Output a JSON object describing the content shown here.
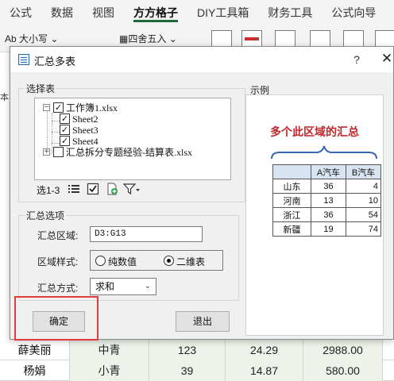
{
  "ribbon": {
    "tabs": [
      "公式",
      "数据",
      "视图",
      "方方格子",
      "DIY工具箱",
      "财务工具",
      "公式向导"
    ],
    "active_tab": "方方格子",
    "tools": {
      "font_case": "Ab 大小写",
      "round": "四舍五入"
    }
  },
  "sheet": {
    "left_partial_text": "本",
    "rows": [
      [
        "薛美丽",
        "中青",
        "123",
        "24.29",
        "2988.00"
      ],
      [
        "杨娟",
        "小青",
        "39",
        "14.87",
        "580.00"
      ]
    ]
  },
  "dialog": {
    "title": "汇总多表",
    "help": "?",
    "close": "✕",
    "select_table": {
      "group_label": "选择表",
      "tree": {
        "workbook1": "工作簿1.xlsx",
        "sheets": [
          "Sheet2",
          "Sheet3",
          "Sheet4"
        ],
        "workbook2": "汇总拆分专题经验-结算表.xlsx"
      },
      "selection_count": "选1-3"
    },
    "options": {
      "group_label": "汇总选项",
      "range_label": "汇总区域:",
      "range_value": "D3:G13",
      "style_label": "区域样式:",
      "style_options": [
        "纯数值",
        "二维表"
      ],
      "style_selected": "二维表",
      "method_label": "汇总方式:",
      "method_value": "求和"
    },
    "ok_button": "确定",
    "exit_button": "退出",
    "example": {
      "label": "示例",
      "title": "多个此区域的汇总",
      "headers": [
        "",
        "A汽车",
        "B汽车"
      ],
      "rows": [
        [
          "山东",
          "36",
          "4"
        ],
        [
          "河南",
          "13",
          "10"
        ],
        [
          "浙江",
          "36",
          "54"
        ],
        [
          "新疆",
          "19",
          "74"
        ]
      ]
    }
  }
}
